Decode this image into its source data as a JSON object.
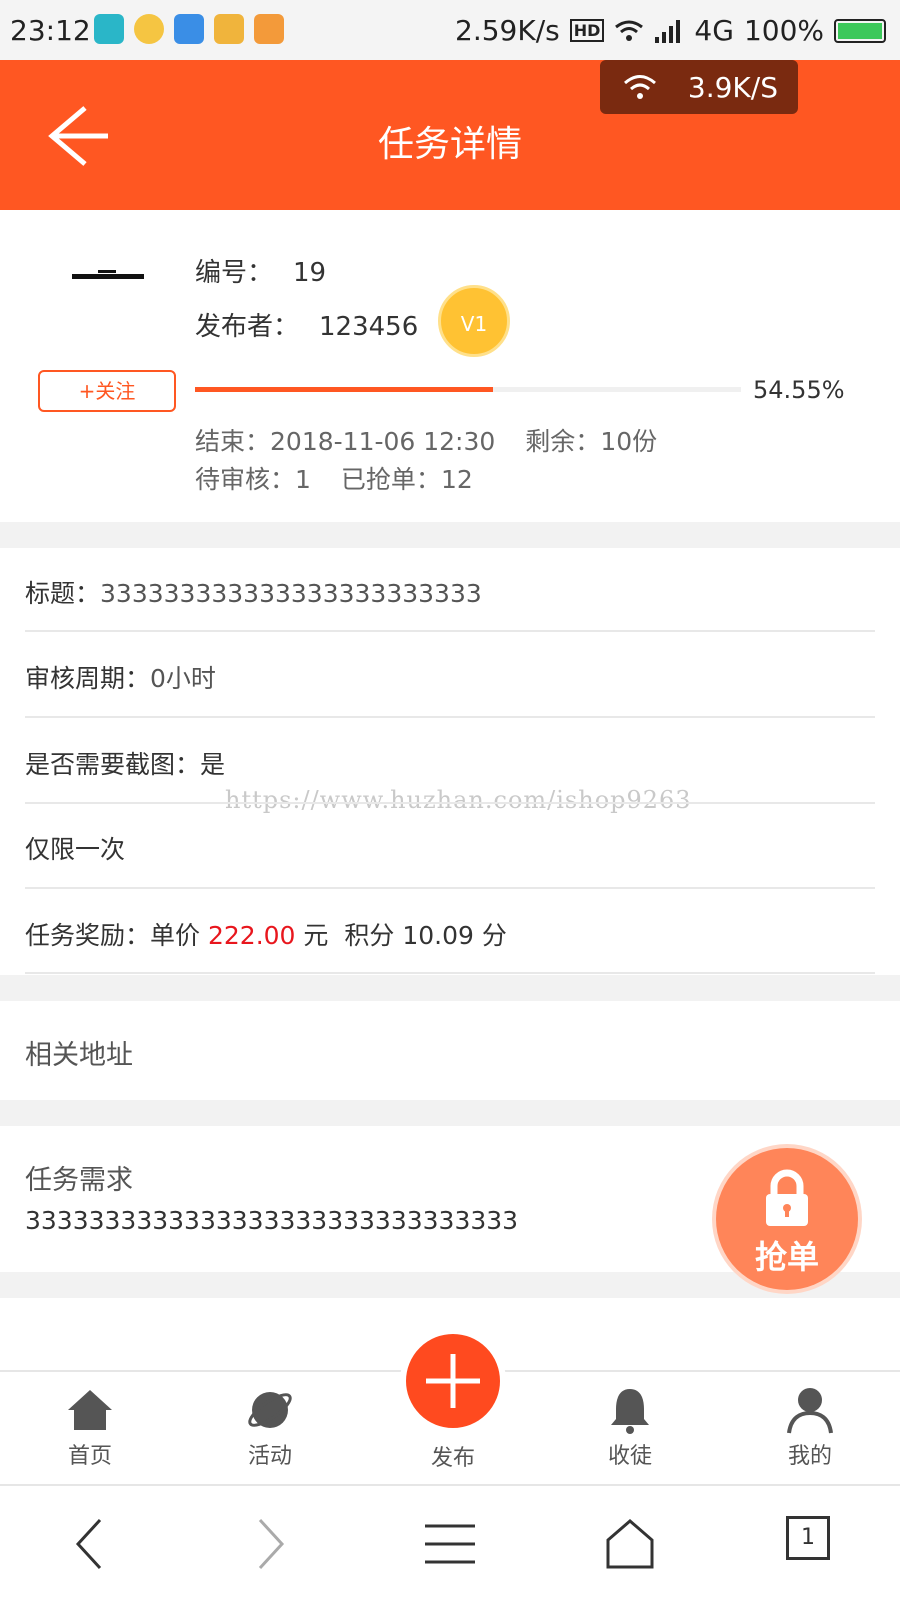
{
  "status_bar": {
    "time": "23:12",
    "net_speed": "2.59K/s",
    "hd_label": "HD",
    "network_type": "4G",
    "battery": "100%",
    "battery_level": 1.0,
    "app_icon_colors": [
      "#2ab6c8",
      "#f5c542",
      "#3a8ee6",
      "#f0b43c",
      "#f39a3a"
    ]
  },
  "header": {
    "title": "任务详情",
    "background": "#ff5722",
    "overlay_speed": "3.9K/S"
  },
  "task_info": {
    "number_label": "编号：",
    "number_value": "19",
    "publisher_label": "发布者：",
    "publisher_value": "123456",
    "vip_level": "V1",
    "follow_label": "+关注",
    "progress_percent": 54.55,
    "progress_text": "54.55%",
    "end_label": "结束：",
    "end_value": "2018-11-06 12:30",
    "remaining_label": "剩余：",
    "remaining_value": "10份",
    "pending_label": "待审核：",
    "pending_value": "1",
    "grabbed_label": "已抢单：",
    "grabbed_value": "12"
  },
  "details": {
    "title_label": "标题：",
    "title_value": "333333333333333333333333",
    "review_label": "审核周期：",
    "review_value": "0小时",
    "screenshot_label": "是否需要截图：",
    "screenshot_value": "是",
    "once_text": "仅限一次",
    "reward_label": "任务奖励：",
    "reward_unit_price_label": "单价",
    "reward_price": "222.00",
    "reward_currency": "元",
    "reward_points_label": "积分",
    "reward_points": "10.09",
    "reward_points_unit": "分"
  },
  "watermark": "https://www.huzhan.com/ishop9263",
  "related_address": {
    "label": "相关地址"
  },
  "requirement": {
    "label": "任务需求",
    "value": "3333333333333333333333333333333"
  },
  "grab_button": {
    "label": "抢单"
  },
  "tab_bar": {
    "items": [
      {
        "label": "首页",
        "icon": "home-icon"
      },
      {
        "label": "活动",
        "icon": "planet-icon"
      },
      {
        "label": "发布",
        "icon": "plus-icon"
      },
      {
        "label": "收徒",
        "icon": "bell-icon"
      },
      {
        "label": "我的",
        "icon": "user-icon"
      }
    ]
  },
  "browser_nav": {
    "tab_count": "1"
  }
}
